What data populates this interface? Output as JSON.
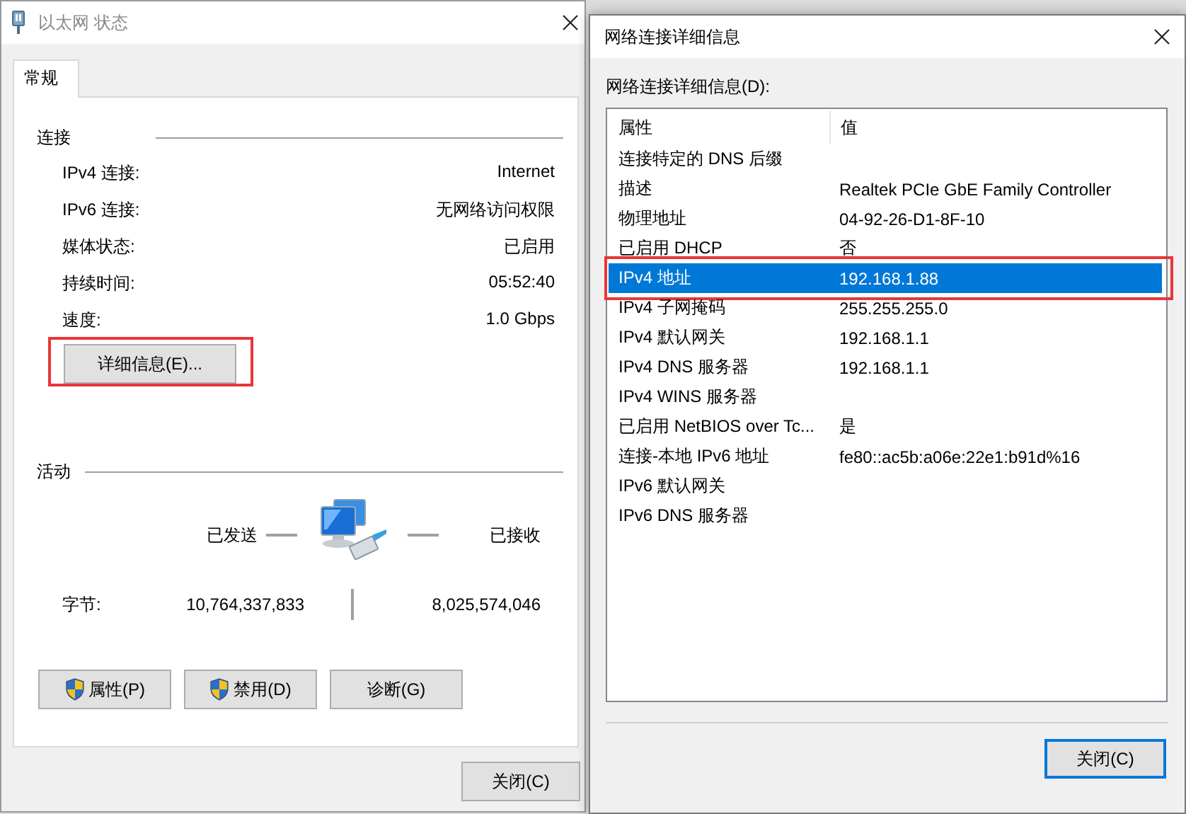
{
  "status_window": {
    "title": "以太网 状态",
    "tabs": [
      {
        "label": "常规",
        "selected": true
      }
    ],
    "connection": {
      "heading": "连接",
      "rows": [
        {
          "label": "IPv4 连接:",
          "value": "Internet"
        },
        {
          "label": "IPv6 连接:",
          "value": "无网络访问权限"
        },
        {
          "label": "媒体状态:",
          "value": "已启用"
        },
        {
          "label": "持续时间:",
          "value": "05:52:40"
        },
        {
          "label": "速度:",
          "value": "1.0 Gbps"
        }
      ]
    },
    "details_button": {
      "label": "详细信息(E)...",
      "highlighted": true
    },
    "activity": {
      "heading": "活动",
      "sent_label": "已发送",
      "received_label": "已接收",
      "bytes_label": "字节:",
      "bytes_sent": "10,764,337,833",
      "bytes_received": "8,025,574,046"
    },
    "buttons": [
      {
        "label": "属性(P)",
        "shield": true
      },
      {
        "label": "禁用(D)",
        "shield": true
      },
      {
        "label": "诊断(G)",
        "shield": false
      }
    ],
    "close_button": "关闭(C)"
  },
  "details_window": {
    "title": "网络连接详细信息",
    "list_label": "网络连接详细信息(D):",
    "columns": [
      "属性",
      "值"
    ],
    "rows": [
      {
        "property": "连接特定的 DNS 后缀",
        "selected": false
      },
      {
        "property": "描述",
        "value": "Realtek PCIe GbE Family Controller",
        "selected": false
      },
      {
        "property": "物理地址",
        "value": "04-92-26-D1-8F-10",
        "selected": false
      },
      {
        "property": "已启用 DHCP",
        "value": "否",
        "selected": false
      },
      {
        "property": "IPv4 地址",
        "value": "192.168.1.88",
        "selected": true,
        "highlighted": true
      },
      {
        "property": "IPv4 子网掩码",
        "value": "255.255.255.0",
        "selected": false
      },
      {
        "property": "IPv4 默认网关",
        "value": "192.168.1.1",
        "selected": false
      },
      {
        "property": "IPv4 DNS 服务器",
        "value": "192.168.1.1",
        "selected": false
      },
      {
        "property": "IPv4 WINS 服务器",
        "selected": false
      },
      {
        "property": "已启用 NetBIOS over Tc...",
        "value": "是",
        "selected": false
      },
      {
        "property": "连接-本地 IPv6 地址",
        "value": "fe80::ac5b:a06e:22e1:b91d%16",
        "selected": false
      },
      {
        "property": "IPv6 默认网关",
        "selected": false
      },
      {
        "property": "IPv6 DNS 服务器",
        "selected": false
      }
    ],
    "close_button": "关闭(C)"
  }
}
